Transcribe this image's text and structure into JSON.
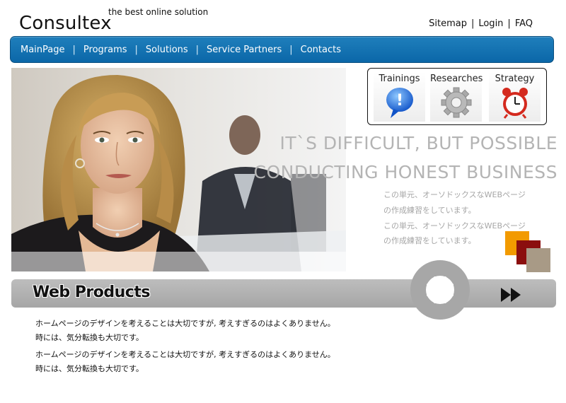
{
  "header": {
    "logo": "Consultex",
    "tagline": "the best online solution",
    "links": [
      "Sitemap",
      "Login",
      "FAQ"
    ]
  },
  "nav": {
    "items": [
      "MainPage",
      "Programs",
      "Solutions",
      "Service Partners",
      "Contacts"
    ]
  },
  "features": [
    {
      "label": "Trainings",
      "icon": "speech-bubble-icon"
    },
    {
      "label": "Researches",
      "icon": "gear-icon"
    },
    {
      "label": "Strategy",
      "icon": "alarm-clock-icon"
    }
  ],
  "slogan": {
    "line1": "IT`S DIFFICULT, BUT POSSIBLE",
    "line2": "CONDUCTING HONEST BUSINESS"
  },
  "intro_text": {
    "line1": "この単元、オーソドックスなWEBページ",
    "line2": "の作成練習をしています。",
    "line3": "この単元、オーソドックスなWEBページ",
    "line4": "の作成練習をしています。"
  },
  "products": {
    "title": "Web Products",
    "paragraphs": [
      {
        "line1": "ホームページのデザインを考えることは大切ですが,  考えすぎるのはよくありません。",
        "line2": "時には、気分転換も大切です。"
      },
      {
        "line1": "ホームページのデザインを考えることは大切ですが,  考えすぎるのはよくありません。",
        "line2": "時には、気分転換も大切です。"
      }
    ]
  },
  "colors": {
    "nav": "#0b67a8",
    "orange": "#f29a00",
    "maroon": "#8b0e0e",
    "taupe": "#a89a86",
    "gray_bar": "#a6a6a6"
  }
}
